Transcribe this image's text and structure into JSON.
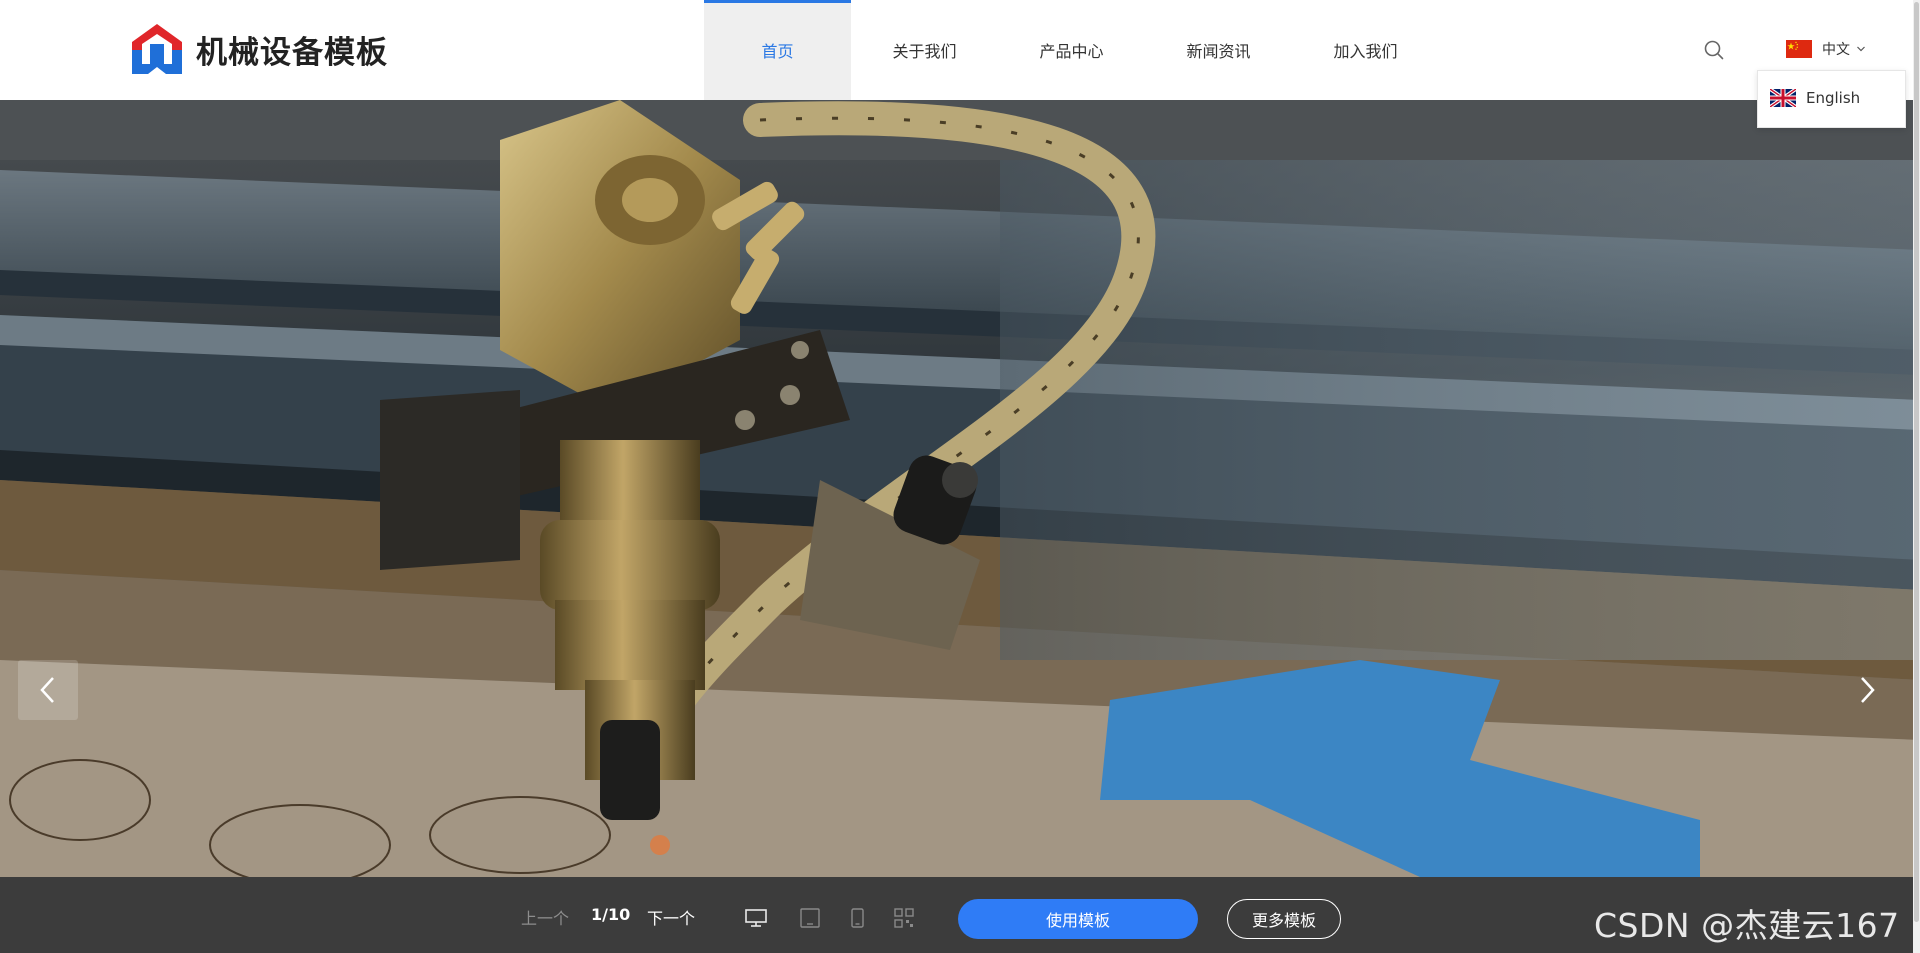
{
  "header": {
    "logo_text": "机械设备模板",
    "nav": [
      {
        "label": "首页",
        "active": true
      },
      {
        "label": "关于我们",
        "active": false
      },
      {
        "label": "产品中心",
        "active": false
      },
      {
        "label": "新闻资讯",
        "active": false
      },
      {
        "label": "加入我们",
        "active": false
      }
    ],
    "search_icon": "search-icon",
    "language": {
      "current": "中文",
      "current_flag": "china-flag-icon",
      "options": [
        {
          "label": "English",
          "flag": "uk-flag-icon"
        }
      ]
    }
  },
  "hero": {
    "image_subject": "laser-cutter-head-photo",
    "prev_icon": "chevron-left-icon",
    "next_icon": "chevron-right-icon"
  },
  "toolbar": {
    "prev_label": "上一个",
    "page_indicator": "1/10",
    "next_label": "下一个",
    "device_icons": [
      "desktop-icon",
      "tablet-icon",
      "mobile-icon",
      "qrcode-icon"
    ],
    "use_template_label": "使用模板",
    "more_templates_label": "更多模板",
    "watermark": "CSDN @杰建云167"
  },
  "colors": {
    "accent": "#2a78e4",
    "button_blue": "#2f7cf6",
    "toolbar_bg": "#3c3c3c",
    "logo_red": "#e0262a",
    "logo_blue": "#1f6fd8"
  }
}
